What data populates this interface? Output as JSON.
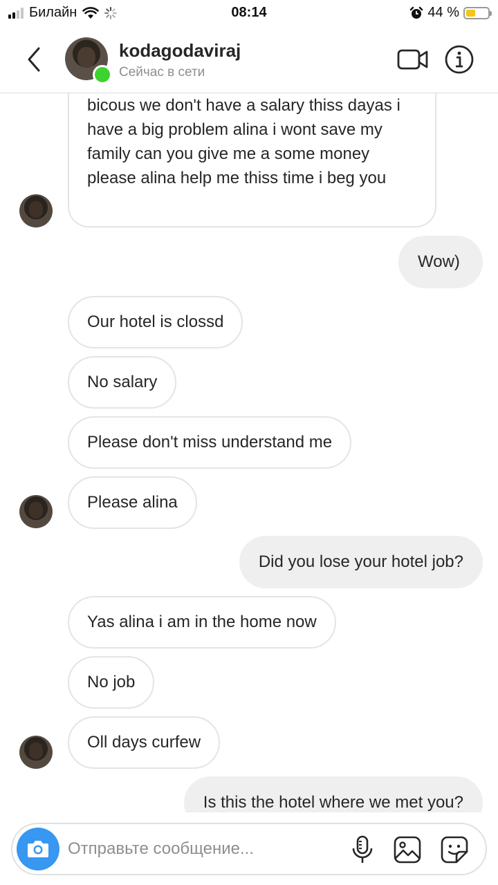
{
  "status_bar": {
    "carrier": "Билайн",
    "time": "08:14",
    "battery_percent": "44 %",
    "battery_level": 0.44,
    "battery_color": "#f5c518"
  },
  "header": {
    "username": "kodagodaviraj",
    "status": "Сейчас в сети",
    "online_color": "#3cd32f",
    "icons": [
      "chevron-left-icon",
      "video-camera-icon",
      "info-icon"
    ]
  },
  "messages": [
    {
      "side": "in",
      "text": "bicous we don't have a salary thiss dayas i have a big problem alina i wont save my family can you give me a some money please alina help me thiss time i beg you"
    },
    {
      "side": "out",
      "text": "Wow)"
    },
    {
      "side": "in",
      "text": "Our hotel is clossd"
    },
    {
      "side": "in",
      "text": "No salary"
    },
    {
      "side": "in",
      "text": "Please don't miss understand me"
    },
    {
      "side": "in",
      "text": "Please alina"
    },
    {
      "side": "out",
      "text": "Did you lose your hotel job?"
    },
    {
      "side": "in",
      "text": "Yas alina i am in the home now"
    },
    {
      "side": "in",
      "text": "No job"
    },
    {
      "side": "in",
      "text": "Oll days curfew"
    },
    {
      "side": "out",
      "text": "Is this the hotel where we met you?"
    }
  ],
  "composer": {
    "placeholder": "Отправьте сообщение...",
    "accent_color": "#3897f0",
    "icons": [
      "camera-icon",
      "microphone-icon",
      "gallery-icon",
      "sticker-icon"
    ]
  }
}
